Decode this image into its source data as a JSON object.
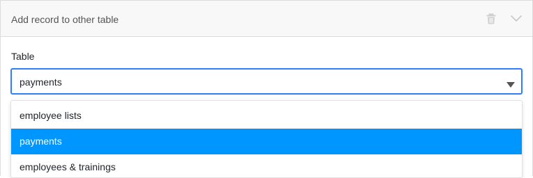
{
  "panel": {
    "title": "Add record to other table",
    "icons": {
      "delete": "trash-icon",
      "collapse": "chevron-down-icon"
    }
  },
  "table_field": {
    "label": "Table",
    "value": "payments"
  },
  "dropdown": {
    "options": [
      {
        "label": "employee lists",
        "selected": false
      },
      {
        "label": "payments",
        "selected": true
      },
      {
        "label": "employees & trainings",
        "selected": false
      }
    ]
  },
  "colors": {
    "accent_border": "#2d7ff9",
    "selected_option_bg": "#0096ff"
  }
}
